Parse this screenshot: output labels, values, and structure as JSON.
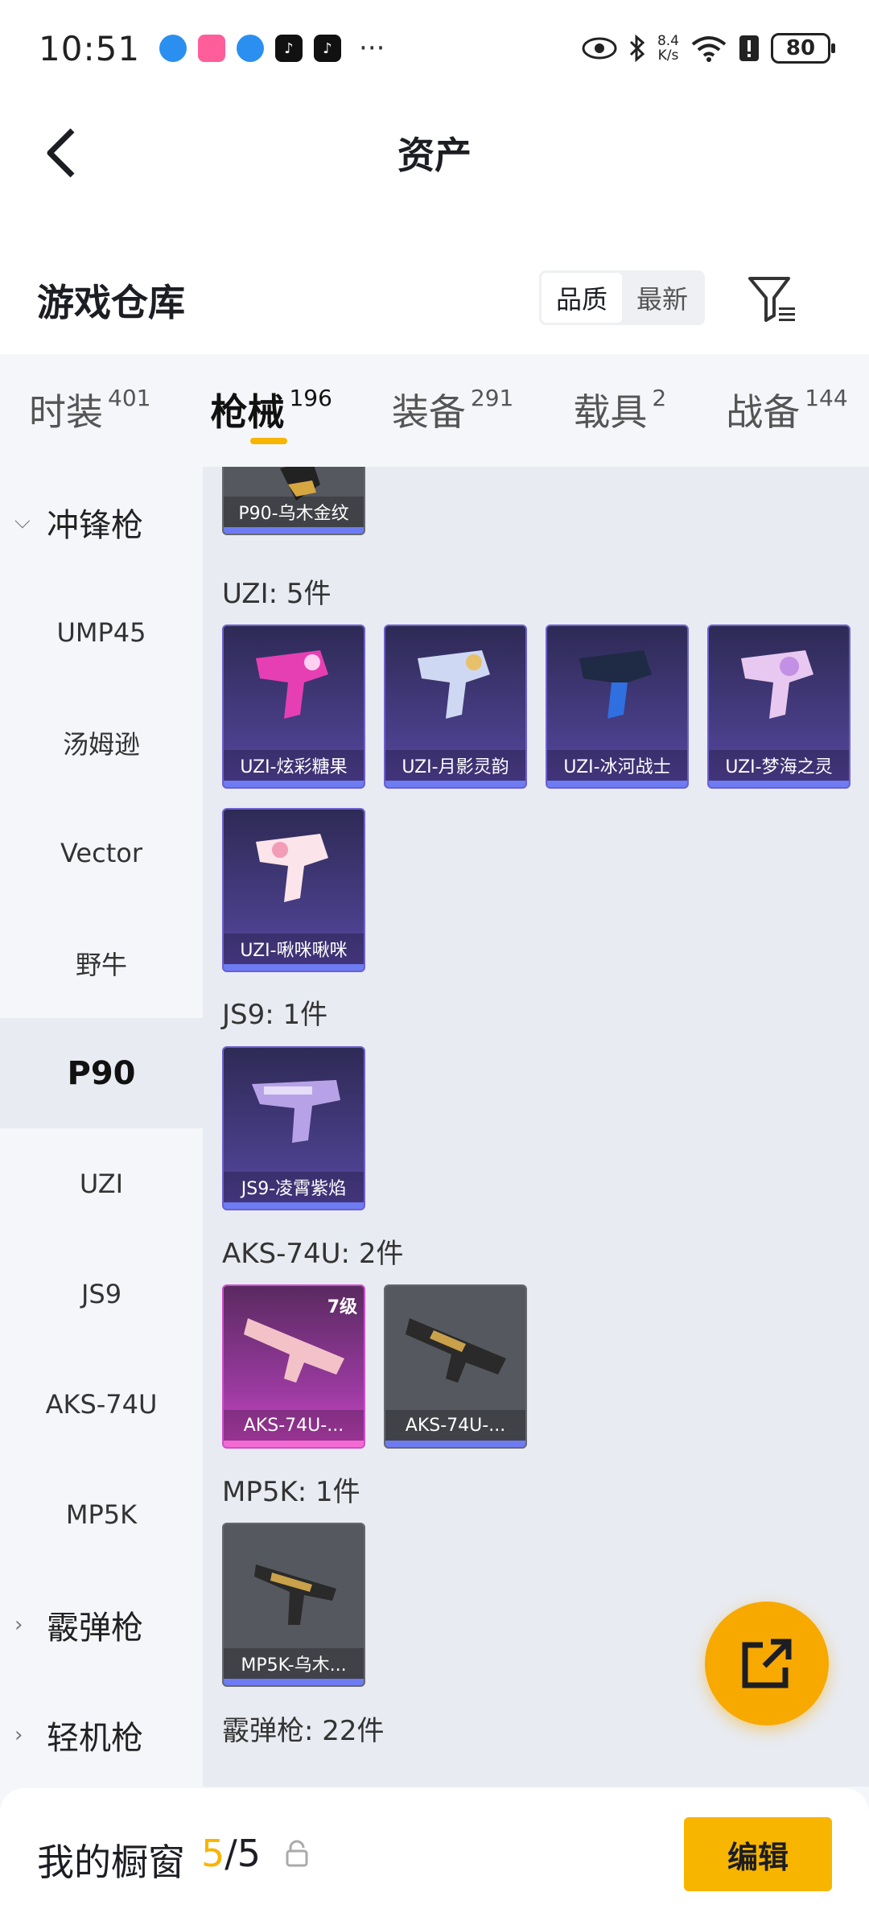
{
  "status_bar": {
    "time": "10:51",
    "net_speed_value": "8.4",
    "net_speed_unit": "K/s",
    "battery": "80",
    "more": "···"
  },
  "nav": {
    "title": "资产"
  },
  "header": {
    "section_title": "游戏仓库",
    "sort_options": [
      "品质",
      "最新"
    ],
    "active_sort": "品质"
  },
  "tabs": [
    {
      "label": "时装",
      "count": "401"
    },
    {
      "label": "枪械",
      "count": "196"
    },
    {
      "label": "装备",
      "count": "291"
    },
    {
      "label": "载具",
      "count": "2"
    },
    {
      "label": "战备",
      "count": "144"
    }
  ],
  "active_tab": "枪械",
  "sidebar": {
    "group1": "冲锋枪",
    "items": [
      "UMP45",
      "汤姆逊",
      "Vector",
      "野牛",
      "P90",
      "UZI",
      "JS9",
      "AKS-74U",
      "MP5K"
    ],
    "group2": "霰弹枪",
    "group3": "轻机枪",
    "active_item": "P90"
  },
  "content": {
    "partial_card": "P90-乌木金纹",
    "groups": [
      {
        "label": "UZI: 5件",
        "items": [
          "UZI-炫彩糖果",
          "UZI-月影灵韵",
          "UZI-冰河战士",
          "UZI-梦海之灵",
          "UZI-啾咪啾咪"
        ]
      },
      {
        "label": "JS9: 1件",
        "items": [
          "JS9-凌霄紫焰"
        ]
      },
      {
        "label": "AKS-74U: 2件",
        "items": [
          "AKS-74U-...",
          "AKS-74U-..."
        ],
        "level": "7级"
      },
      {
        "label": "MP5K: 1件",
        "items": [
          "MP5K-乌木..."
        ]
      },
      {
        "label": "霰弹枪: 22件"
      }
    ]
  },
  "bottom": {
    "title": "我的橱窗",
    "current": "5",
    "separator": "/",
    "total": "5",
    "edit_label": "编辑"
  },
  "colors": {
    "accent": "#f7b500",
    "purple_rarity": "#6d7cf2",
    "pink_rarity": "#f36bd2"
  }
}
